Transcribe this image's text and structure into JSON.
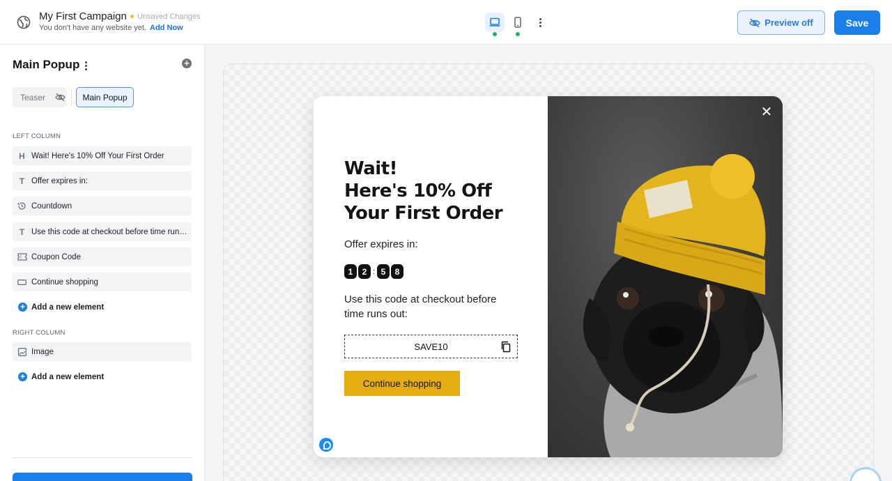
{
  "header": {
    "campaign_title": "My First Campaign",
    "unsaved": "Unsaved Changes",
    "no_website_text": "You don't have any website yet.",
    "add_now": "Add Now",
    "preview_label": "Preview off",
    "save_label": "Save",
    "active_device": "desktop"
  },
  "sidebar": {
    "title": "Main Popup",
    "tabs": {
      "teaser": "Teaser",
      "main": "Main Popup"
    },
    "left_section": "LEFT COLUMN",
    "left_items": [
      {
        "icon": "heading-icon",
        "glyph": "H",
        "label": "Wait! Here's 10% Off Your First Order"
      },
      {
        "icon": "text-icon",
        "glyph": "T",
        "label": "Offer expires in:"
      },
      {
        "icon": "countdown-icon",
        "glyph": "",
        "label": "Countdown"
      },
      {
        "icon": "text-icon",
        "glyph": "T",
        "label": "Use this code at checkout before time runs out:"
      },
      {
        "icon": "coupon-icon",
        "glyph": "",
        "label": "Coupon Code"
      },
      {
        "icon": "button-icon",
        "glyph": "",
        "label": "Continue shopping"
      }
    ],
    "add_element": "Add a new element",
    "right_section": "RIGHT COLUMN",
    "right_items": [
      {
        "icon": "image-icon",
        "glyph": "",
        "label": "Image"
      }
    ]
  },
  "popup": {
    "headline_lines": [
      "Wait!",
      "Here's 10% Off",
      "Your First Order"
    ],
    "expires_label": "Offer expires in:",
    "countdown": {
      "minutes": [
        "1",
        "2"
      ],
      "separator": ":",
      "seconds": [
        "5",
        "8"
      ]
    },
    "use_code_text": "Use this code at checkout before time runs out:",
    "coupon_code": "SAVE10",
    "cta_label": "Continue shopping",
    "close_glyph": "✕",
    "cta_color": "#E6AD12"
  },
  "colors": {
    "accent": "#1A7FE8",
    "unsaved_dot": "#F4C120",
    "device_indicator": "#1DB45A"
  }
}
